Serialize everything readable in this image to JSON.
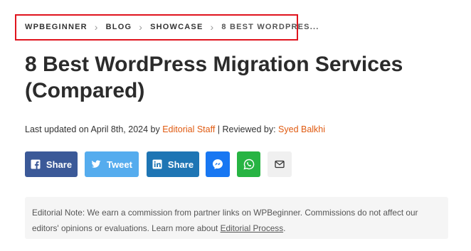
{
  "breadcrumb": {
    "items": [
      "WPBEGINNER",
      "BLOG",
      "SHOWCASE"
    ],
    "current": "8 BEST WORDPRES...",
    "highlight_color": "#e0141e"
  },
  "article": {
    "title": "8 Best WordPress Migration Services (Compared)",
    "meta": {
      "updated_prefix": "Last updated on April 8th, 2024 by ",
      "author": "Editorial Staff",
      "reviewed_prefix": " | Reviewed by: ",
      "reviewer": "Syed Balkhi",
      "link_color": "#e05a10"
    }
  },
  "share": {
    "facebook": {
      "label": "Share",
      "icon": "facebook-icon",
      "color": "#3b5998"
    },
    "twitter": {
      "label": "Tweet",
      "icon": "twitter-icon",
      "color": "#55acee"
    },
    "linkedin": {
      "label": "Share",
      "icon": "linkedin-icon",
      "color": "#1e75b4"
    },
    "messenger": {
      "icon": "messenger-icon",
      "color": "#1877f2"
    },
    "whatsapp": {
      "icon": "whatsapp-icon",
      "color": "#27b443"
    },
    "email": {
      "icon": "envelope-icon",
      "color": "#f0f0f0"
    }
  },
  "note": {
    "text": "Editorial Note: We earn a commission from partner links on WPBeginner. Commissions do not affect our editors' opinions or evaluations. Learn more about ",
    "link": "Editorial Process",
    "suffix": "."
  }
}
